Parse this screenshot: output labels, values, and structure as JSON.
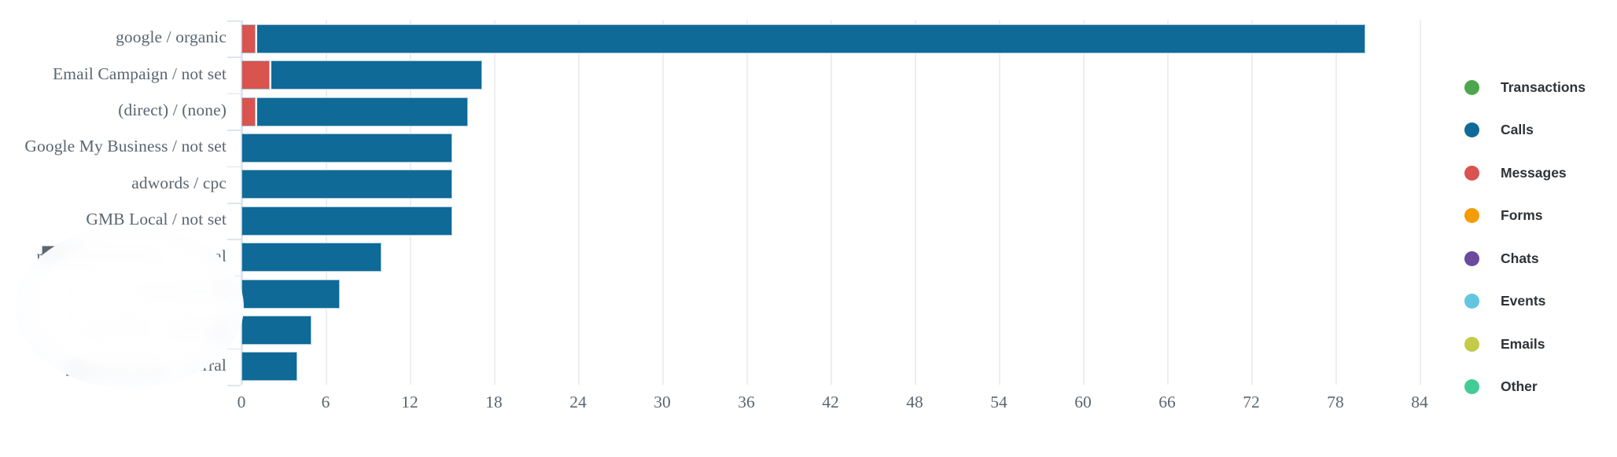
{
  "chart_data": {
    "type": "bar",
    "orientation": "horizontal",
    "stacked": true,
    "title": "",
    "subtitle": "",
    "xlabel": "",
    "ylabel": "",
    "xlim": [
      0,
      84
    ],
    "xticks": [
      0,
      6,
      12,
      18,
      24,
      30,
      36,
      42,
      48,
      54,
      60,
      66,
      72,
      78,
      84
    ],
    "xtick_labels": [
      "0",
      "6",
      "12",
      "18",
      "24",
      "30",
      "36",
      "42",
      "48",
      "54",
      "60",
      "66",
      "72",
      "78",
      "84"
    ],
    "grid": "vertical",
    "legend_position": "right",
    "categories": [
      "google / organic",
      "Email Campaign / not set",
      "(direct) / (none)",
      "Google My Business / not set",
      "adwords / cpc",
      "GMB Local / not set",
      "r██████████ / referral",
      "████████",
      "██████ / █████",
      "████████ / referral"
    ],
    "categories_redacted": [
      false,
      false,
      false,
      false,
      false,
      false,
      true,
      true,
      true,
      true
    ],
    "series": [
      {
        "name": "Transactions",
        "color": "#4ca74c",
        "values": [
          0,
          0,
          0,
          0,
          0,
          0,
          0,
          0,
          0,
          0
        ]
      },
      {
        "name": "Calls",
        "color": "#0f6a97",
        "values": [
          79,
          15,
          15,
          15,
          15,
          15,
          10,
          7,
          5,
          4
        ]
      },
      {
        "name": "Messages",
        "color": "#d9534f",
        "values": [
          1,
          2,
          1,
          0,
          0,
          0,
          0,
          0,
          0,
          0
        ]
      },
      {
        "name": "Forms",
        "color": "#f59b05",
        "values": [
          0,
          0,
          0,
          0,
          0,
          0,
          0,
          0,
          0,
          0
        ]
      },
      {
        "name": "Chats",
        "color": "#6a4a9c",
        "values": [
          0,
          0,
          0,
          0,
          0,
          0,
          0,
          0,
          0,
          0
        ]
      },
      {
        "name": "Events",
        "color": "#62c6e0",
        "values": [
          0,
          0,
          0,
          0,
          0,
          0,
          0,
          0,
          0,
          0
        ]
      },
      {
        "name": "Emails",
        "color": "#c2cc49",
        "values": [
          0,
          0,
          0,
          0,
          0,
          0,
          0,
          0,
          0,
          0
        ]
      },
      {
        "name": "Other",
        "color": "#44cc96",
        "values": [
          0,
          0,
          0,
          0,
          0,
          0,
          0,
          0,
          0,
          0
        ]
      }
    ],
    "totals": [
      80,
      17,
      16,
      15,
      15,
      15,
      10,
      7,
      5,
      4
    ],
    "stack_order": [
      "Messages",
      "Calls"
    ]
  },
  "legend": {
    "items": [
      {
        "label": "Transactions",
        "color": "#4ca74c"
      },
      {
        "label": "Calls",
        "color": "#0f6a97"
      },
      {
        "label": "Messages",
        "color": "#d9534f"
      },
      {
        "label": "Forms",
        "color": "#f59b05"
      },
      {
        "label": "Chats",
        "color": "#6a4a9c"
      },
      {
        "label": "Events",
        "color": "#62c6e0"
      },
      {
        "label": "Emails",
        "color": "#c2cc49"
      },
      {
        "label": "Other",
        "color": "#44cc96"
      }
    ]
  },
  "colors": {
    "axis_line": "#dde5f0",
    "gridline": "#edeff2",
    "tick_text": "#5b6670",
    "legend_text": "#2e3338",
    "bar_stroke": "#a7c7da",
    "background": "#ffffff"
  }
}
